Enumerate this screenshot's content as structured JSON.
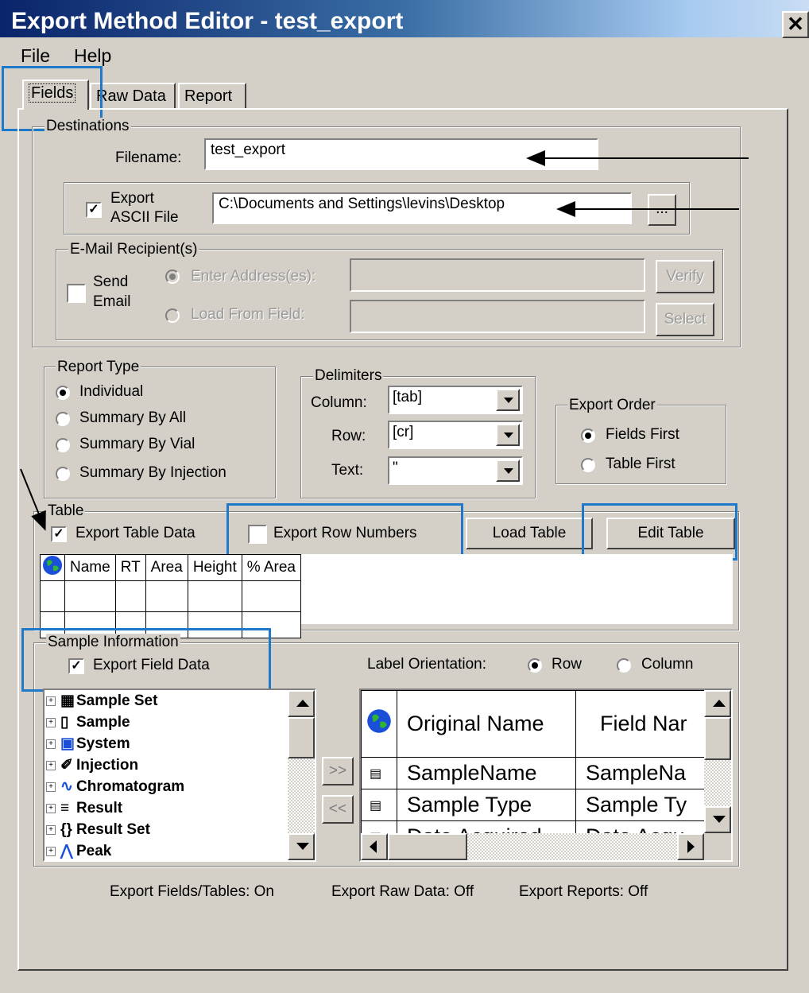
{
  "window": {
    "title": "Export Method Editor - test_export",
    "close_glyph": "✕"
  },
  "menu": {
    "file": "File",
    "help": "Help"
  },
  "tabs": [
    "Fields",
    "Raw Data",
    "Report"
  ],
  "destinations": {
    "group_label": "Destinations",
    "filename_label": "Filename:",
    "filename_value": "test_export",
    "export_ascii_label_1": "Export",
    "export_ascii_label_2": "ASCII File",
    "export_ascii_checked": true,
    "path_value": "C:\\Documents and Settings\\levins\\Desktop",
    "browse_label": "...",
    "email": {
      "group_label": "E-Mail Recipient(s)",
      "send_label_1": "Send",
      "send_label_2": "Email",
      "enter_label": "Enter Address(es):",
      "load_label": "Load From Field:",
      "verify_label": "Verify",
      "select_label": "Select"
    }
  },
  "report_type": {
    "group_label": "Report Type",
    "options": [
      "Individual",
      "Summary By All",
      "Summary By Vial",
      "Summary By Injection"
    ],
    "selected": "Individual"
  },
  "delimiters": {
    "group_label": "Delimiters",
    "column_label": "Column:",
    "column_value": "[tab]",
    "row_label": "Row:",
    "row_value": "[cr]",
    "text_label": "Text:",
    "text_value": "\""
  },
  "export_order": {
    "group_label": "Export Order",
    "options": [
      "Fields First",
      "Table First"
    ],
    "selected": "Fields First"
  },
  "table": {
    "group_label": "Table",
    "export_table_label": "Export Table Data",
    "export_table_checked": true,
    "export_rows_label": "Export Row Numbers",
    "export_rows_checked": false,
    "load_table_label": "Load Table",
    "edit_table_label": "Edit Table",
    "columns": [
      "Name",
      "RT",
      "Area",
      "Height",
      "% Area"
    ]
  },
  "sample_info": {
    "group_label": "Sample Information",
    "export_field_label": "Export Field Data",
    "export_field_checked": true,
    "orientation_label": "Label Orientation:",
    "row_label": "Row",
    "column_label": "Column",
    "orientation_selected": "Row",
    "tree": [
      {
        "label": "Sample Set",
        "icon": "sample-set-icon"
      },
      {
        "label": "Sample",
        "icon": "vial-icon"
      },
      {
        "label": "System",
        "icon": "system-icon"
      },
      {
        "label": "Injection",
        "icon": "syringe-icon"
      },
      {
        "label": "Chromatogram",
        "icon": "chromatogram-icon"
      },
      {
        "label": "Result",
        "icon": "result-icon"
      },
      {
        "label": "Result Set",
        "icon": "result-set-icon"
      },
      {
        "label": "Peak",
        "icon": "peak-icon"
      }
    ],
    "add_label": ">>",
    "remove_label": "<<",
    "grid_headers": [
      "Original Name",
      "Field Nar"
    ],
    "grid_rows": [
      [
        "SampleName",
        "SampleNa"
      ],
      [
        "Sample Type",
        "Sample Ty"
      ],
      [
        "Date Acquired",
        "Date Acqu"
      ]
    ]
  },
  "status": {
    "fields": "Export Fields/Tables: On",
    "raw": "Export Raw Data: Off",
    "reports": "Export Reports: Off"
  },
  "colors": {
    "highlight": "#1f78c8",
    "face": "#d4d0c8",
    "title_start": "#0a246a"
  }
}
